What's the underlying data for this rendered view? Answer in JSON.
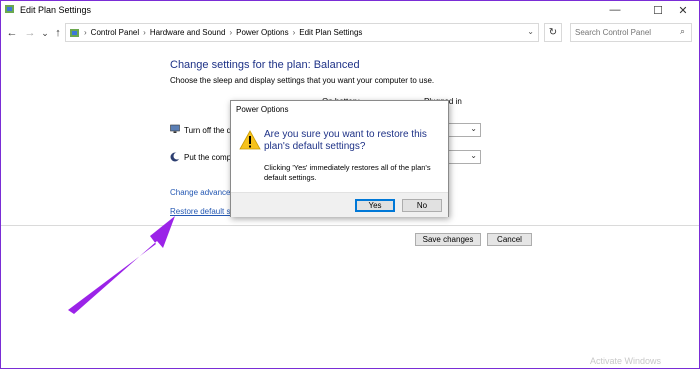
{
  "window": {
    "title": "Edit Plan Settings",
    "minimize_glyph": "—",
    "maximize_glyph": "☐",
    "close_glyph": "✕"
  },
  "nav": {
    "back_glyph": "←",
    "forward_glyph": "→",
    "recent_glyph": "⌄",
    "up_glyph": "↑",
    "breadcrumbs": [
      "Control Panel",
      "Hardware and Sound",
      "Power Options",
      "Edit Plan Settings"
    ],
    "separator": "›",
    "refresh_glyph": "↻",
    "search_placeholder": "Search Control Panel"
  },
  "main": {
    "heading": "Change settings for the plan: Balanced",
    "subheading": "Choose the sleep and display settings that you want your computer to use.",
    "col_on_battery": "On battery",
    "col_plugged_in": "Plugged in",
    "setting_display": "Turn off the d",
    "setting_sleep": "Put the comp",
    "link_advanced": "Change advanced",
    "link_restore": "Restore default set",
    "save_label": "Save changes",
    "cancel_label": "Cancel"
  },
  "dialog": {
    "title": "Power Options",
    "question": "Are you sure you want to restore this plan's default settings?",
    "detail": "Clicking 'Yes' immediately restores all of the plan's default settings.",
    "yes_label": "Yes",
    "no_label": "No"
  },
  "watermark": "Activate Windows",
  "colors": {
    "heading_blue": "#1e3287",
    "link_blue": "#2458b3",
    "arrow_purple": "#9b23e8",
    "warning_yellow": "#f6c21c"
  },
  "icons": {
    "app": "control-panel-icon",
    "warning": "warning-icon",
    "display": "monitor-icon",
    "sleep": "moon-icon",
    "annotation": "arrow-annotation"
  }
}
